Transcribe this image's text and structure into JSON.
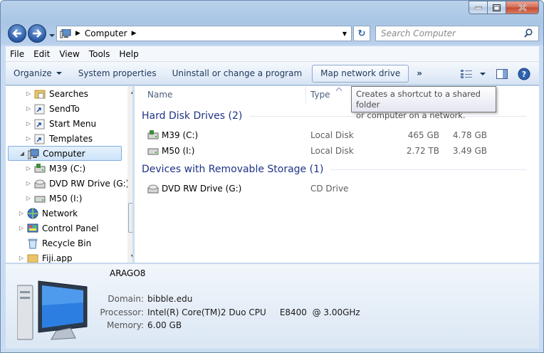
{
  "window": {
    "caption_buttons": [
      "minimize",
      "maximize",
      "close"
    ]
  },
  "address": {
    "crumbs": [
      "Computer"
    ],
    "icon": "computer-icon"
  },
  "search": {
    "placeholder": "Search Computer"
  },
  "menubar": {
    "items": [
      "File",
      "Edit",
      "View",
      "Tools",
      "Help"
    ]
  },
  "command_bar": {
    "items": [
      "Organize",
      "System properties",
      "Uninstall or change a program",
      "Map network drive"
    ],
    "more": "»"
  },
  "nav_tree": [
    {
      "label": "Searches",
      "icon": "folder-icon"
    },
    {
      "label": "SendTo",
      "icon": "folder-icon"
    },
    {
      "label": "Start Menu",
      "icon": "folder-icon"
    },
    {
      "label": "Templates",
      "icon": "folder-icon"
    },
    {
      "label": "Computer",
      "icon": "computer-icon"
    },
    {
      "label": "M39 (C:)",
      "icon": "hard-drive-icon"
    },
    {
      "label": "DVD RW Drive (G:)",
      "icon": "dvd-drive-icon"
    },
    {
      "label": "M50 (I:)",
      "icon": "hard-drive-icon"
    },
    {
      "label": "Network",
      "icon": "network-icon"
    },
    {
      "label": "Control Panel",
      "icon": "control-panel-icon"
    },
    {
      "label": "Recycle Bin",
      "icon": "recycle-bin-icon"
    },
    {
      "label": "Fiji.app",
      "icon": "folder-icon"
    }
  ],
  "columns": {
    "name": "Name",
    "type": "Type"
  },
  "groups": [
    {
      "title": "Hard Disk Drives (2)",
      "drives": [
        {
          "name": "M39 (C:)",
          "type": "Local Disk",
          "total": "465 GB",
          "free": "4.78 GB"
        },
        {
          "name": "M50 (I:)",
          "type": "Local Disk",
          "total": "2.72 TB",
          "free": "3.49 GB"
        }
      ]
    },
    {
      "title": "Devices with Removable Storage (1)",
      "drives": [
        {
          "name": "DVD RW Drive (G:)",
          "type": "CD Drive",
          "total": "",
          "free": ""
        }
      ]
    }
  ],
  "tooltip": {
    "line1": "Creates a shortcut to a shared folder",
    "line2": "or computer on a network."
  },
  "details": {
    "computer_name": "ARAGO8",
    "domain_label": "Domain:",
    "domain": "bibble.edu",
    "processor_label": "Processor:",
    "processor": "Intel(R) Core(TM)2 Duo CPU     E8400  @ 3.00GHz",
    "memory_label": "Memory:",
    "memory": "6.00 GB"
  },
  "colors": {
    "group_title": "#1e3287",
    "nav_button": "#2658a6",
    "close_button": "#c24a32"
  }
}
